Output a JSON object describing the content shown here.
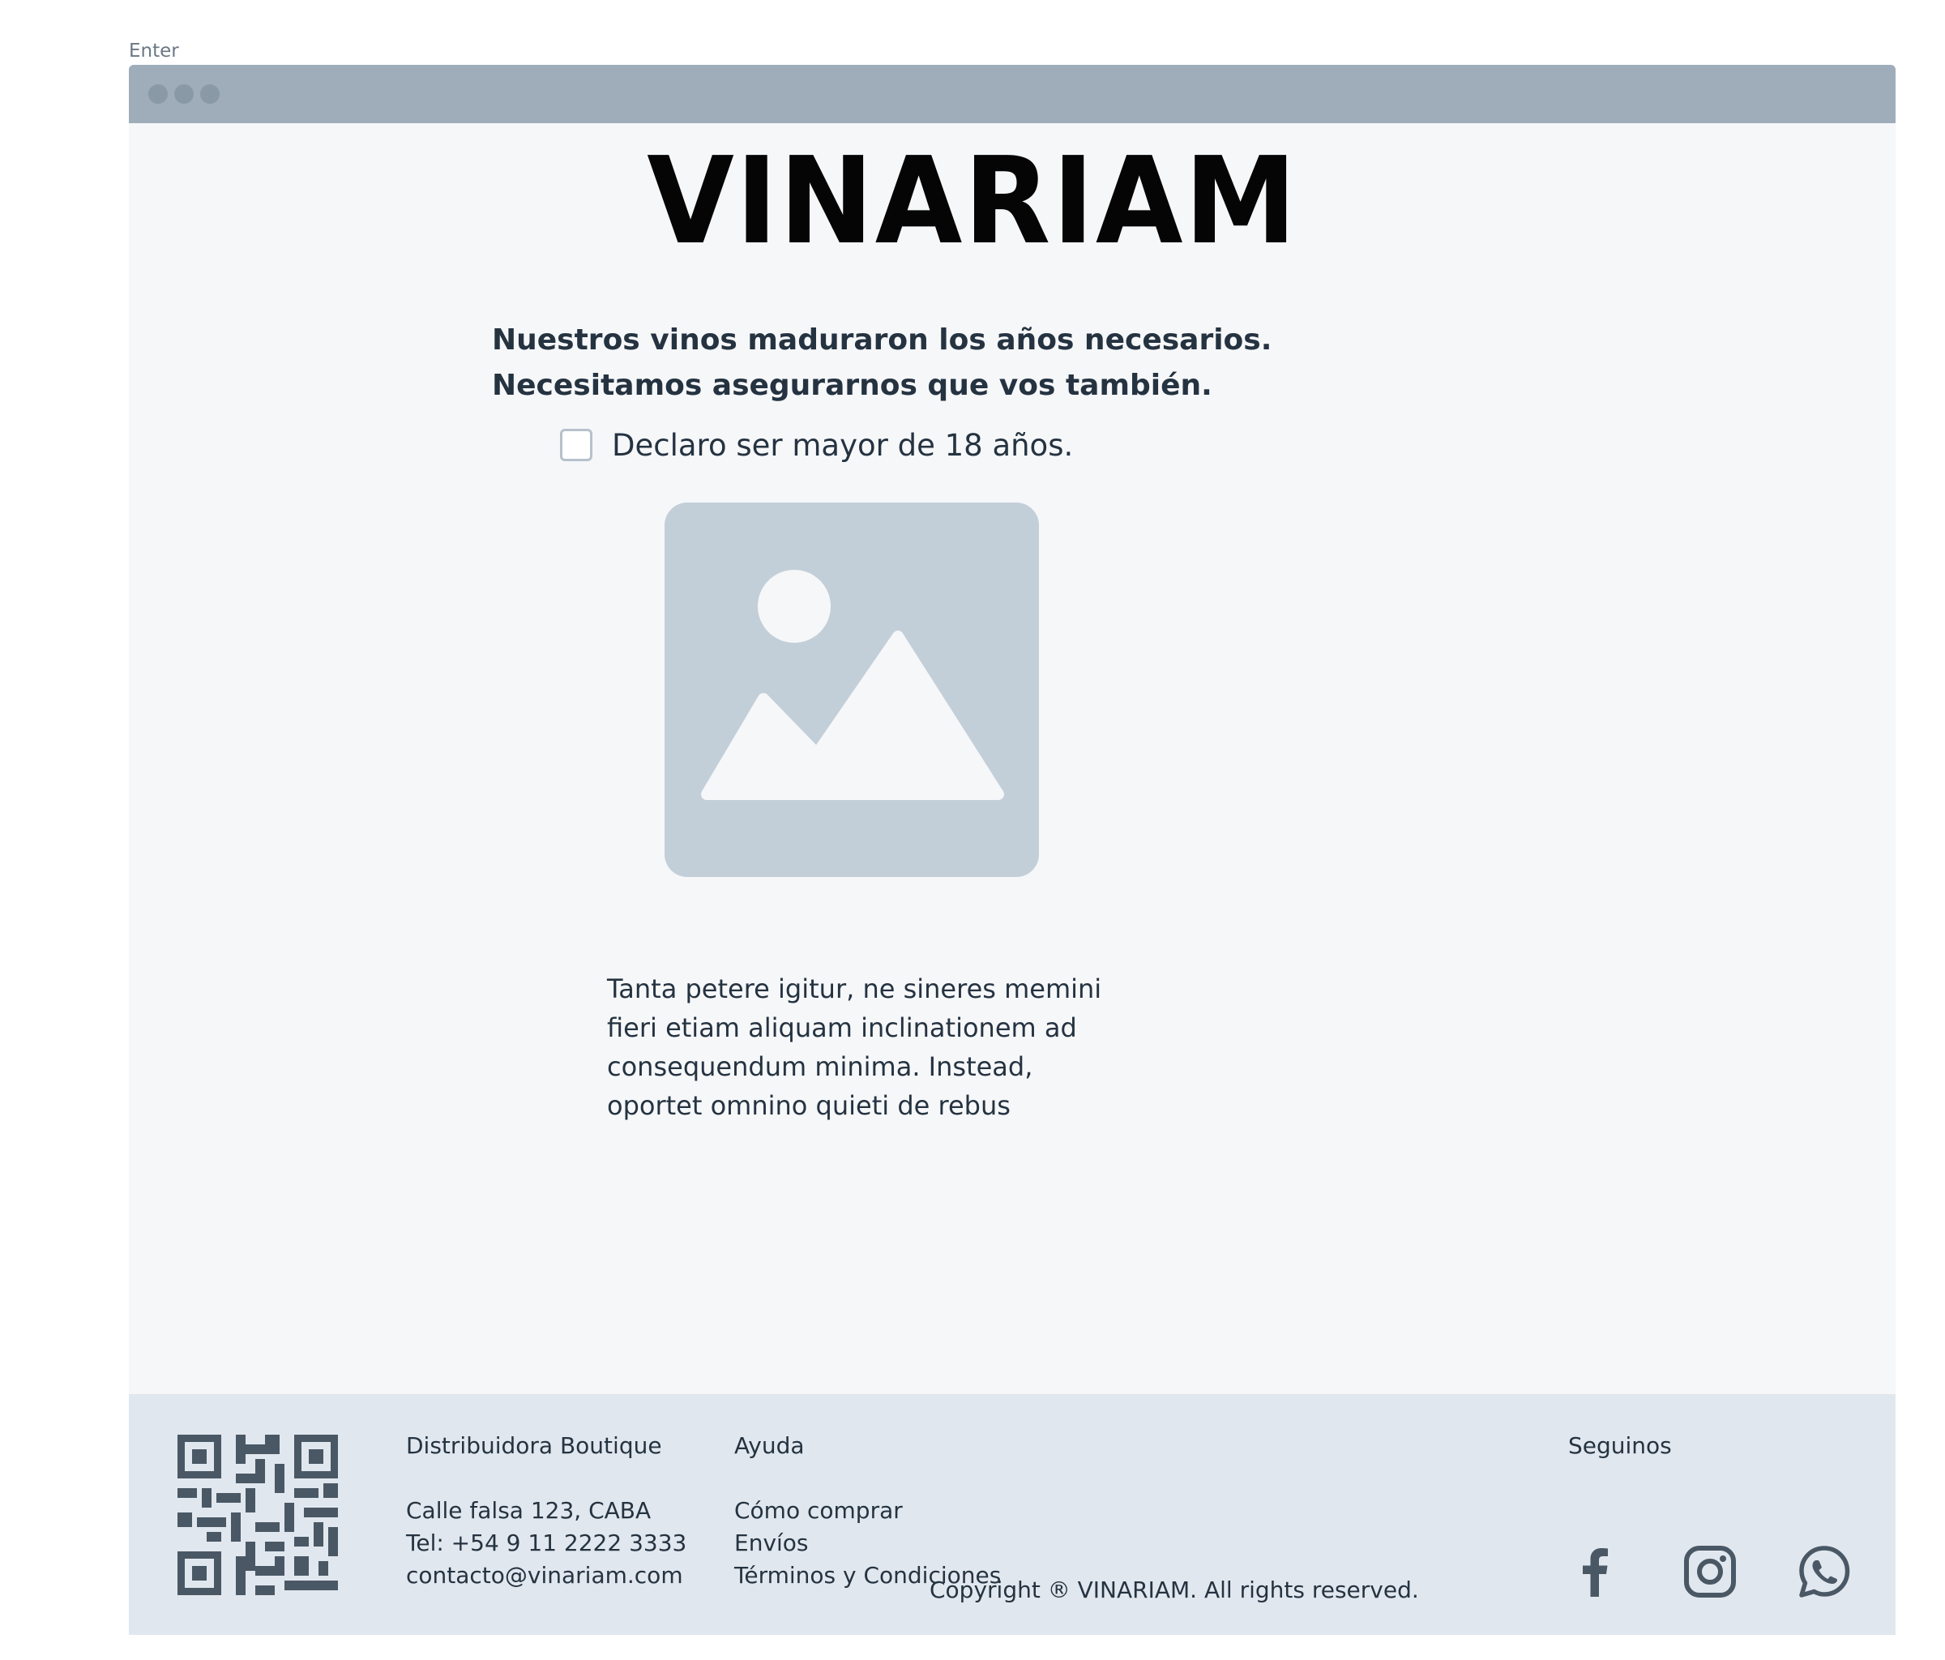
{
  "frame": {
    "label": "Enter"
  },
  "brand": {
    "logo_text": "VINARIAM"
  },
  "age_gate": {
    "headline_line1": "Nuestros vinos maduraron los años necesarios.",
    "headline_line2": "Necesitamos asegurarnos que vos también.",
    "checkbox_label": "Declaro ser mayor de 18 años.",
    "checkbox_checked": false
  },
  "image": {
    "icon": "image-placeholder-icon"
  },
  "body": {
    "lines": [
      "Tanta petere igitur, ne sineres memini",
      "fieri etiam aliquam inclinationem ad",
      "consequendum minima. Instead,",
      "oportet omnino quieti de rebus"
    ]
  },
  "footer": {
    "qr_icon": "qr-code-icon",
    "company": {
      "title": "Distribuidora Boutique",
      "address": "Calle falsa 123, CABA",
      "phone": "Tel: +54 9 11 2222 3333",
      "email": "contacto@vinariam.com"
    },
    "help": {
      "title": "Ayuda",
      "links": [
        "Cómo comprar",
        "Envíos",
        "Términos y Condiciones"
      ]
    },
    "copyright": "Copyright ® VINARIAM. All rights reserved.",
    "social": {
      "title": "Seguinos",
      "icons": [
        "facebook-icon",
        "instagram-icon",
        "whatsapp-icon"
      ]
    }
  },
  "colors": {
    "window_bg": "#f6f7f9",
    "titlebar": "#9eadb9",
    "text": "#253341",
    "footer_bg": "#e1e7ee",
    "placeholder": "#c3cfd8",
    "icon": "#4a5866"
  }
}
